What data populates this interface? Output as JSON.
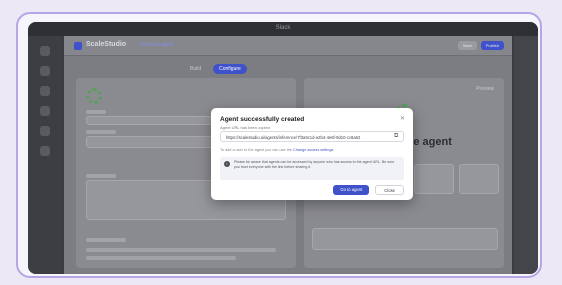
{
  "window": {
    "title": "Slack"
  },
  "header": {
    "brand": "ScaleStudio",
    "breadcrumb": "Post hoc agent",
    "right_buttons": [
      "Publish",
      "Save"
    ]
  },
  "tabs": [
    {
      "label": "Build"
    },
    {
      "label": "Configure"
    }
  ],
  "background": {
    "heading": "erence agent",
    "preview_link": "Preview",
    "sidebar_icons": [
      "home",
      "settings",
      "chart",
      "list",
      "grid",
      "plug"
    ]
  },
  "modal": {
    "title": "Agent successfully created",
    "subtitle": "Agent URL has been copied",
    "url": "https://scalestudio.ai/agents/inference/7f3a9c1d-a2b4-4e6f-9d10-cc8a62",
    "note_prefix": "To add a user to the agent you can use the ",
    "note_link": "Change access settings",
    "info_text": "Please be aware that agents can be accessed by anyone who has access to the agent URL. Be sure you trust everyone with the link before sharing it.",
    "primary_button": "Go to agent",
    "secondary_button": "Close"
  },
  "colors": {
    "accent": "#3f52c9",
    "success": "#58a05a",
    "frame": "#b7a6e6"
  }
}
